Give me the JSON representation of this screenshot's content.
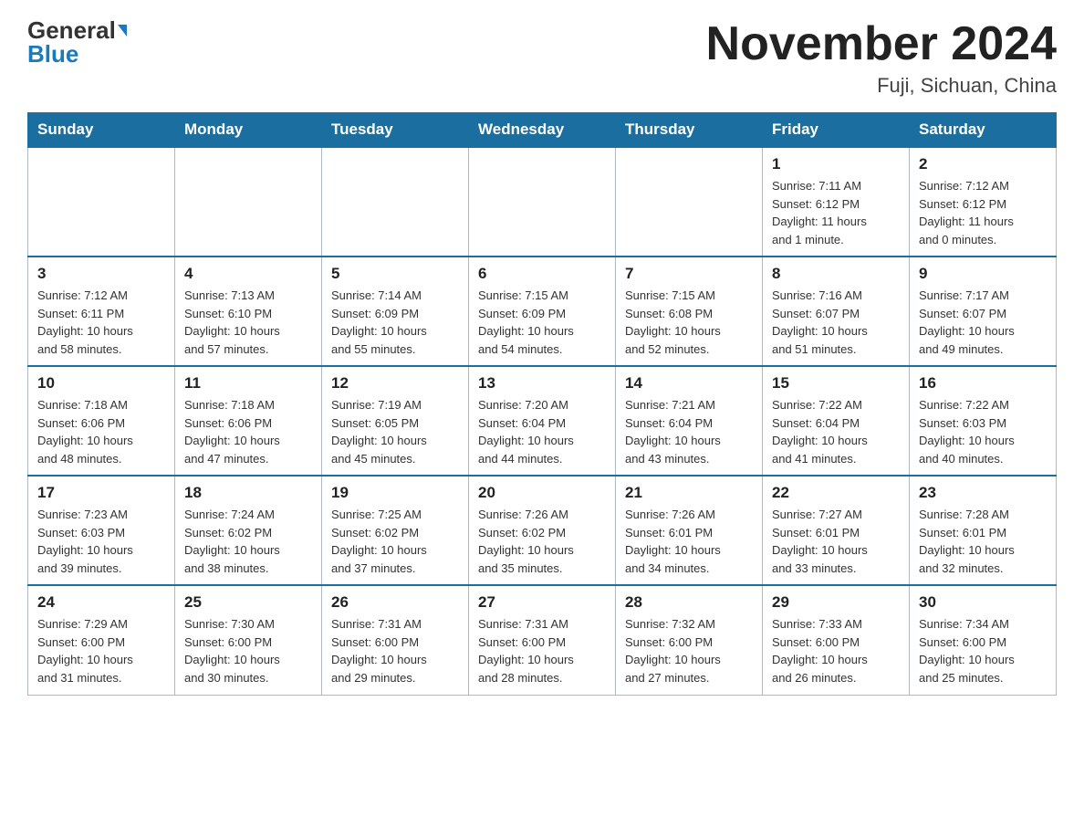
{
  "header": {
    "logo_general": "General",
    "logo_blue": "Blue",
    "title": "November 2024",
    "subtitle": "Fuji, Sichuan, China"
  },
  "days_of_week": [
    "Sunday",
    "Monday",
    "Tuesday",
    "Wednesday",
    "Thursday",
    "Friday",
    "Saturday"
  ],
  "weeks": [
    [
      {
        "day": "",
        "info": ""
      },
      {
        "day": "",
        "info": ""
      },
      {
        "day": "",
        "info": ""
      },
      {
        "day": "",
        "info": ""
      },
      {
        "day": "",
        "info": ""
      },
      {
        "day": "1",
        "info": "Sunrise: 7:11 AM\nSunset: 6:12 PM\nDaylight: 11 hours\nand 1 minute."
      },
      {
        "day": "2",
        "info": "Sunrise: 7:12 AM\nSunset: 6:12 PM\nDaylight: 11 hours\nand 0 minutes."
      }
    ],
    [
      {
        "day": "3",
        "info": "Sunrise: 7:12 AM\nSunset: 6:11 PM\nDaylight: 10 hours\nand 58 minutes."
      },
      {
        "day": "4",
        "info": "Sunrise: 7:13 AM\nSunset: 6:10 PM\nDaylight: 10 hours\nand 57 minutes."
      },
      {
        "day": "5",
        "info": "Sunrise: 7:14 AM\nSunset: 6:09 PM\nDaylight: 10 hours\nand 55 minutes."
      },
      {
        "day": "6",
        "info": "Sunrise: 7:15 AM\nSunset: 6:09 PM\nDaylight: 10 hours\nand 54 minutes."
      },
      {
        "day": "7",
        "info": "Sunrise: 7:15 AM\nSunset: 6:08 PM\nDaylight: 10 hours\nand 52 minutes."
      },
      {
        "day": "8",
        "info": "Sunrise: 7:16 AM\nSunset: 6:07 PM\nDaylight: 10 hours\nand 51 minutes."
      },
      {
        "day": "9",
        "info": "Sunrise: 7:17 AM\nSunset: 6:07 PM\nDaylight: 10 hours\nand 49 minutes."
      }
    ],
    [
      {
        "day": "10",
        "info": "Sunrise: 7:18 AM\nSunset: 6:06 PM\nDaylight: 10 hours\nand 48 minutes."
      },
      {
        "day": "11",
        "info": "Sunrise: 7:18 AM\nSunset: 6:06 PM\nDaylight: 10 hours\nand 47 minutes."
      },
      {
        "day": "12",
        "info": "Sunrise: 7:19 AM\nSunset: 6:05 PM\nDaylight: 10 hours\nand 45 minutes."
      },
      {
        "day": "13",
        "info": "Sunrise: 7:20 AM\nSunset: 6:04 PM\nDaylight: 10 hours\nand 44 minutes."
      },
      {
        "day": "14",
        "info": "Sunrise: 7:21 AM\nSunset: 6:04 PM\nDaylight: 10 hours\nand 43 minutes."
      },
      {
        "day": "15",
        "info": "Sunrise: 7:22 AM\nSunset: 6:04 PM\nDaylight: 10 hours\nand 41 minutes."
      },
      {
        "day": "16",
        "info": "Sunrise: 7:22 AM\nSunset: 6:03 PM\nDaylight: 10 hours\nand 40 minutes."
      }
    ],
    [
      {
        "day": "17",
        "info": "Sunrise: 7:23 AM\nSunset: 6:03 PM\nDaylight: 10 hours\nand 39 minutes."
      },
      {
        "day": "18",
        "info": "Sunrise: 7:24 AM\nSunset: 6:02 PM\nDaylight: 10 hours\nand 38 minutes."
      },
      {
        "day": "19",
        "info": "Sunrise: 7:25 AM\nSunset: 6:02 PM\nDaylight: 10 hours\nand 37 minutes."
      },
      {
        "day": "20",
        "info": "Sunrise: 7:26 AM\nSunset: 6:02 PM\nDaylight: 10 hours\nand 35 minutes."
      },
      {
        "day": "21",
        "info": "Sunrise: 7:26 AM\nSunset: 6:01 PM\nDaylight: 10 hours\nand 34 minutes."
      },
      {
        "day": "22",
        "info": "Sunrise: 7:27 AM\nSunset: 6:01 PM\nDaylight: 10 hours\nand 33 minutes."
      },
      {
        "day": "23",
        "info": "Sunrise: 7:28 AM\nSunset: 6:01 PM\nDaylight: 10 hours\nand 32 minutes."
      }
    ],
    [
      {
        "day": "24",
        "info": "Sunrise: 7:29 AM\nSunset: 6:00 PM\nDaylight: 10 hours\nand 31 minutes."
      },
      {
        "day": "25",
        "info": "Sunrise: 7:30 AM\nSunset: 6:00 PM\nDaylight: 10 hours\nand 30 minutes."
      },
      {
        "day": "26",
        "info": "Sunrise: 7:31 AM\nSunset: 6:00 PM\nDaylight: 10 hours\nand 29 minutes."
      },
      {
        "day": "27",
        "info": "Sunrise: 7:31 AM\nSunset: 6:00 PM\nDaylight: 10 hours\nand 28 minutes."
      },
      {
        "day": "28",
        "info": "Sunrise: 7:32 AM\nSunset: 6:00 PM\nDaylight: 10 hours\nand 27 minutes."
      },
      {
        "day": "29",
        "info": "Sunrise: 7:33 AM\nSunset: 6:00 PM\nDaylight: 10 hours\nand 26 minutes."
      },
      {
        "day": "30",
        "info": "Sunrise: 7:34 AM\nSunset: 6:00 PM\nDaylight: 10 hours\nand 25 minutes."
      }
    ]
  ]
}
